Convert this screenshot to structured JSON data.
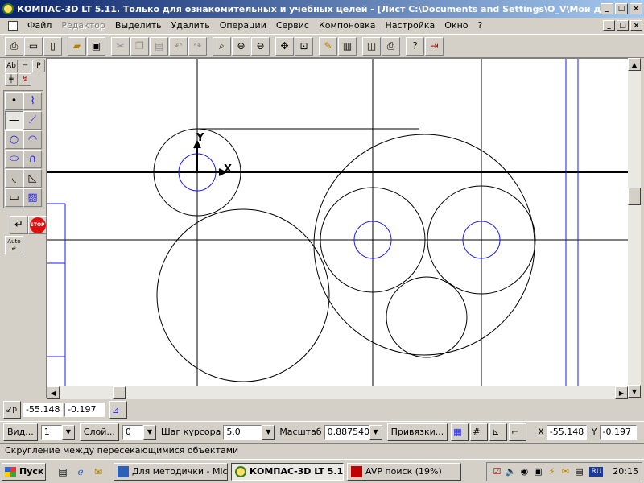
{
  "window": {
    "title": "КОМПАС-3D LT 5.11. Только для ознакомительных и учебных целей - [Лист C:\\Documents and Settings\\O_V\\Мои докумен...",
    "controls": [
      "_",
      "□",
      "×"
    ]
  },
  "menu": {
    "items": [
      "Файл",
      "Редактор",
      "Выделить",
      "Удалить",
      "Операции",
      "Сервис",
      "Компоновка",
      "Настройка",
      "Окно",
      "?"
    ],
    "disabled_index": 1
  },
  "toolbar": {
    "icons": [
      "print-setup-icon",
      "new-sheet-icon",
      "new-document-icon",
      "open-folder-icon",
      "save-icon",
      "cut-icon",
      "copy-icon",
      "paste-icon",
      "undo-icon",
      "redo-icon",
      "zoom-window-icon",
      "zoom-in-icon",
      "zoom-out-icon",
      "pan-icon",
      "zoom-all-icon",
      "properties-icon",
      "layers-icon",
      "preview-icon",
      "print-icon",
      "help-icon",
      "exit-icon"
    ]
  },
  "left_toolbar": {
    "top_labels": [
      "Аb",
      "Р"
    ],
    "auto_label": "Auto",
    "stop_label": "STOP"
  },
  "coords": {
    "x": "-55.148",
    "y": "-0.197",
    "label_p": "р"
  },
  "params": {
    "view_button": "Вид...",
    "view_value": "1",
    "layer_button": "Слой...",
    "layer_value": "0",
    "step_label": "Шаг курсора",
    "step_value": "5.0",
    "scale_label": "Масштаб",
    "scale_value": "0.887540",
    "snaps_button": "Привязки...",
    "x_label": "X",
    "x_value": "-55.148",
    "y_label": "Y",
    "y_value": "-0.197"
  },
  "status": {
    "text": "Скругление между пересекающимися объектами"
  },
  "taskbar": {
    "start": "Пуск",
    "tasks": [
      "Для методички - Mic...",
      "КОМПАС-3D LT 5.1...",
      "AVP поиск (19%)"
    ],
    "active_task": 1,
    "lang": "RU",
    "clock": "20:15"
  },
  "drawing": {
    "axis_x_label": "X",
    "axis_y_label": "Y",
    "colors": {
      "geometry": "#000000",
      "construction": "#1a1aff",
      "background": "#ffffff"
    }
  }
}
